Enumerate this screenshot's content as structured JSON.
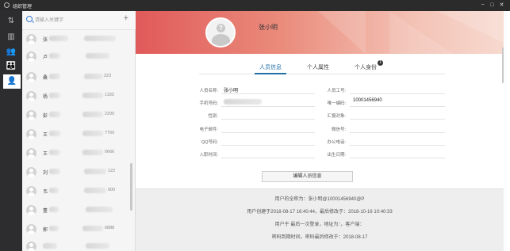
{
  "window": {
    "title": "组织管理"
  },
  "search": {
    "placeholder": "请输入关键字",
    "add_label": "+"
  },
  "leftbar": {
    "icons": [
      "sort-icon",
      "building-icon",
      "group-icon",
      "org-icon",
      "user-card-icon"
    ]
  },
  "contacts": [
    {
      "name": "张",
      "tail": ""
    },
    {
      "name": "卢",
      "tail": ""
    },
    {
      "name": "桑",
      "tail": "223"
    },
    {
      "name": "杨",
      "tail": "1183"
    },
    {
      "name": "彭",
      "tail": "2200"
    },
    {
      "name": "王",
      "tail": "7760"
    },
    {
      "name": "王",
      "tail": "0666"
    },
    {
      "name": "刘",
      "tail": "122"
    },
    {
      "name": "韦",
      "tail": "000"
    },
    {
      "name": "董",
      "tail": ""
    },
    {
      "name": "郭",
      "tail": "6888"
    },
    {
      "name": "",
      "tail": ""
    }
  ],
  "profile": {
    "name": "张小明",
    "tabs": [
      {
        "label": "人员信息"
      },
      {
        "label": "个人属性"
      },
      {
        "label": "个人身份"
      }
    ],
    "badge": "1",
    "fields_left": [
      {
        "label": "人员名称:",
        "value": "张小明"
      },
      {
        "label": "手机号码:",
        "value": ""
      },
      {
        "label": "性别:",
        "value": ""
      },
      {
        "label": "电子邮件:",
        "value": ""
      },
      {
        "label": "QQ号码:",
        "value": ""
      },
      {
        "label": "入职时间:",
        "value": ""
      }
    ],
    "fields_right": [
      {
        "label": "人员工号:",
        "value": ""
      },
      {
        "label": "唯一编码:",
        "value": "10001456940"
      },
      {
        "label": "汇报对象:",
        "value": ""
      },
      {
        "label": "微信号:",
        "value": ""
      },
      {
        "label": "办公电话:",
        "value": ""
      },
      {
        "label": "出生日期:",
        "value": ""
      }
    ],
    "edit_button": "编辑人员信息",
    "footer_lines": [
      "用户的全称为：张小明@10001456940@P",
      "用户创建于2018-08-17 16:40:44，最后修改于：2018-10-16 10:40:33",
      "用户于 最后一次登录，地址为：，客户端：",
      "密码到期时间，密码最后修改于：2018-08-17"
    ]
  }
}
